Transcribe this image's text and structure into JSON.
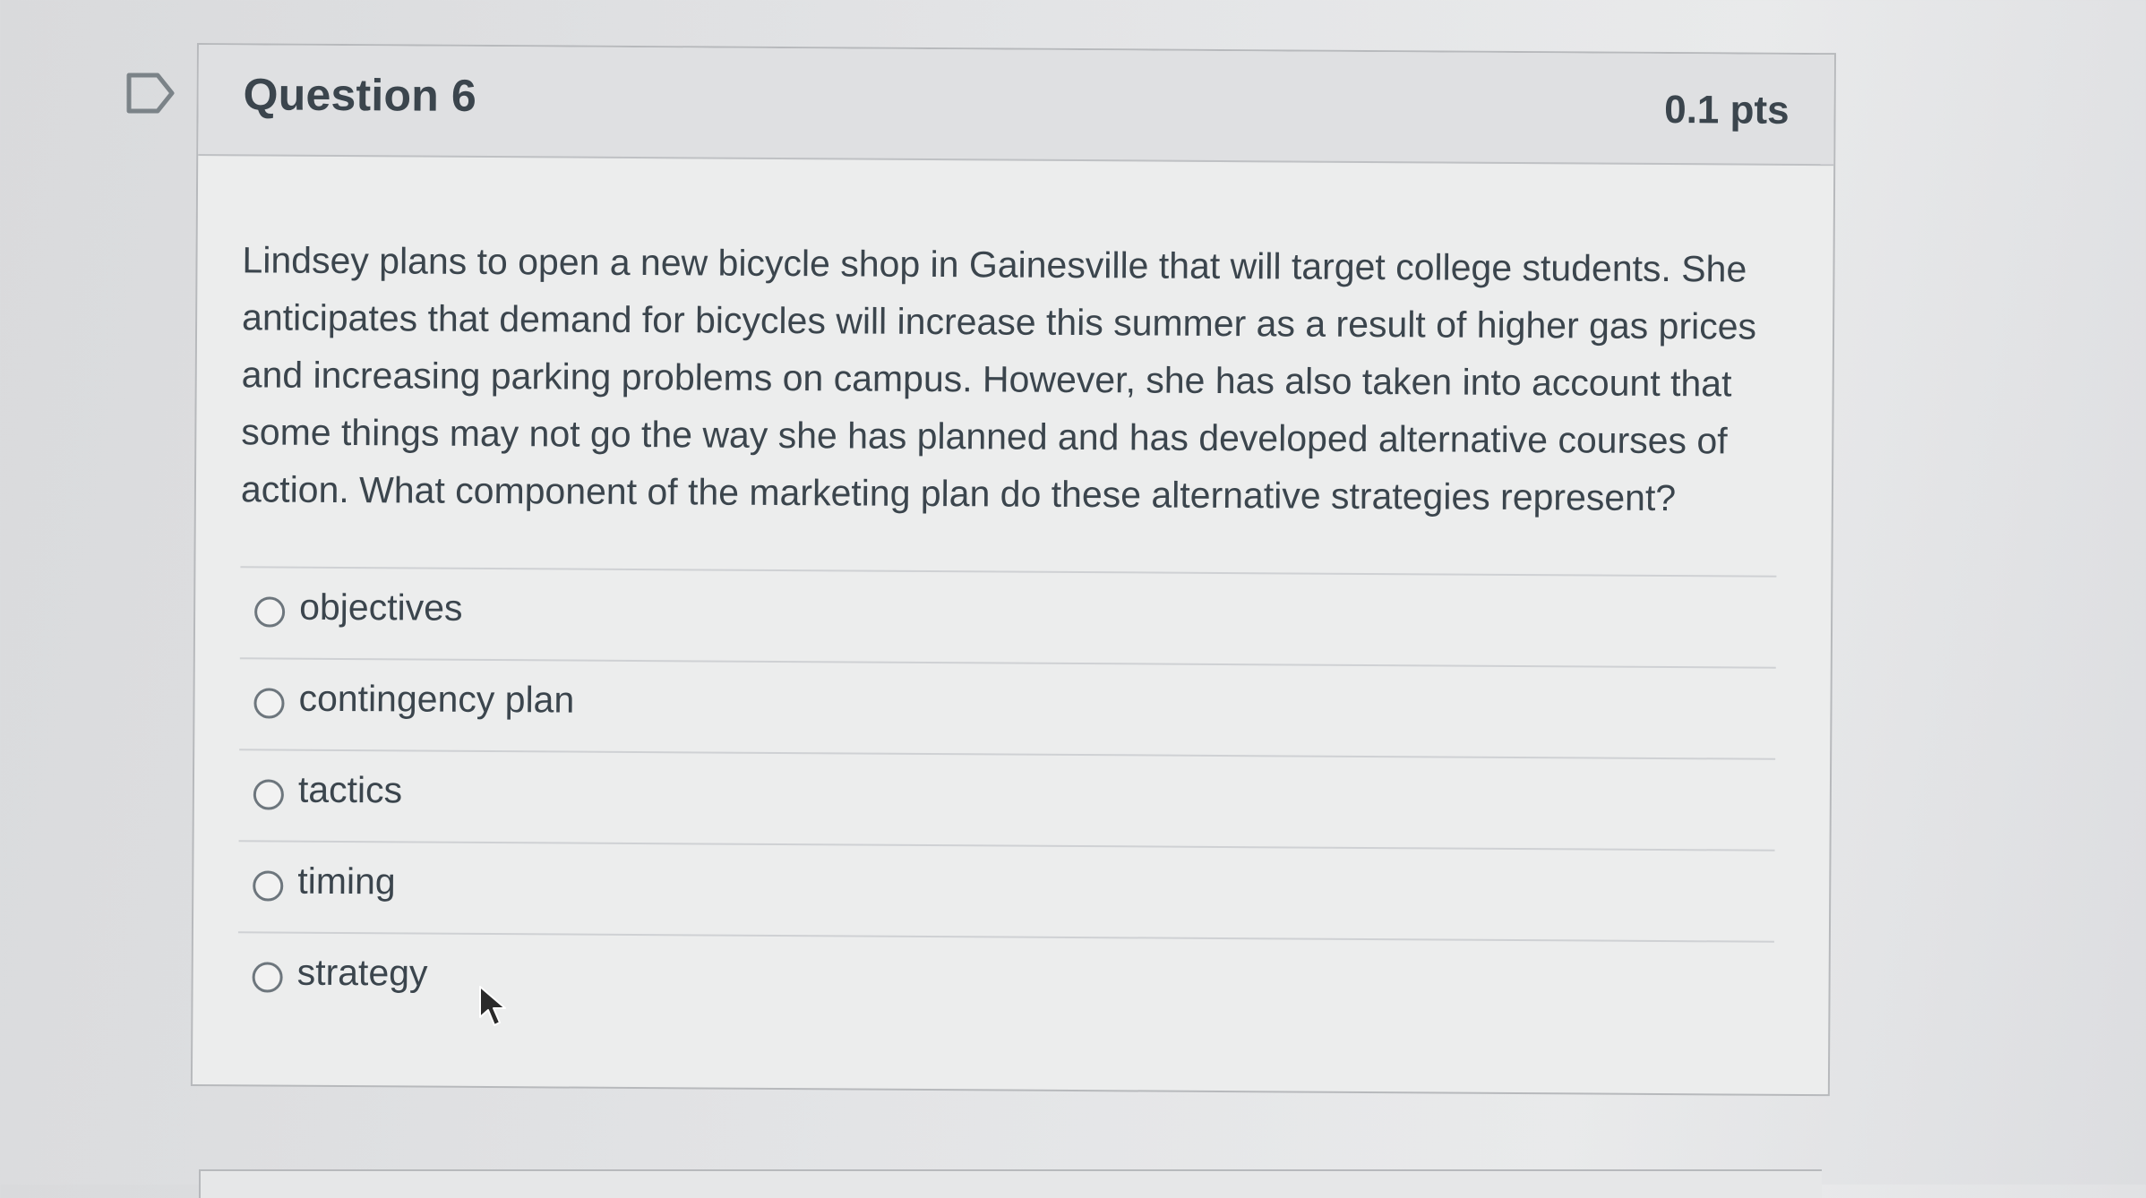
{
  "question": {
    "title": "Question 6",
    "points": "0.1 pts",
    "text": "Lindsey plans to open a new bicycle shop in Gainesville that will target college students. She anticipates that demand for bicycles will increase this summer as a result of higher gas prices and increasing parking problems on campus. However, she has also taken into account that some things may not go the way she has planned and has developed alternative courses of action. What component of the marketing plan do these alternative strategies represent?",
    "answers": [
      {
        "label": "objectives",
        "selected": false
      },
      {
        "label": "contingency plan",
        "selected": false
      },
      {
        "label": "tactics",
        "selected": false
      },
      {
        "label": "timing",
        "selected": false
      },
      {
        "label": "strategy",
        "selected": false
      }
    ]
  },
  "icons": {
    "flag": "bookmark-flag-icon",
    "cursor": "mouse-pointer-icon"
  },
  "colors": {
    "text": "#3b454d",
    "header_bg": "#dfe0e2",
    "card_bg": "#eceded",
    "border": "#b7b9bc"
  }
}
